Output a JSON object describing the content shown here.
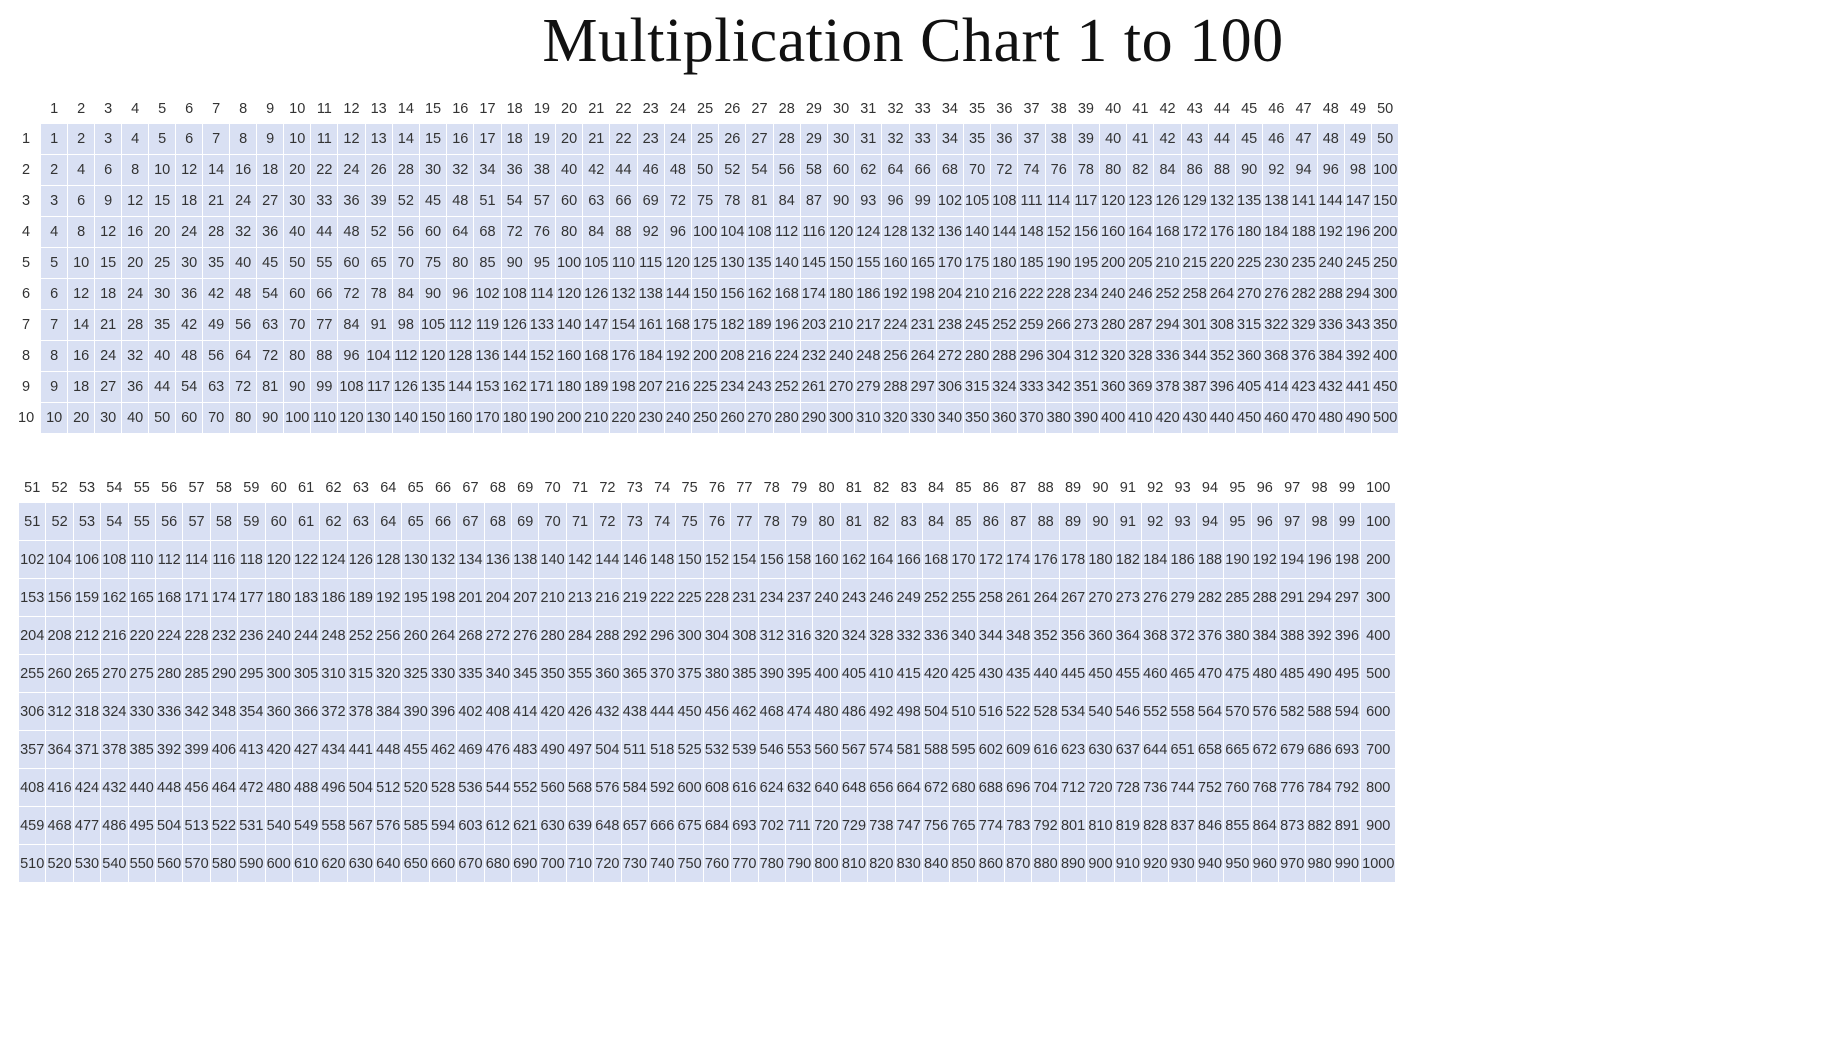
{
  "title": "Multiplication Chart 1 to 100",
  "chart_data": [
    {
      "type": "table",
      "title": "Rows 1–10 × Columns 1–50",
      "col_headers": [
        1,
        2,
        3,
        4,
        5,
        6,
        7,
        8,
        9,
        10,
        11,
        12,
        13,
        14,
        15,
        16,
        17,
        18,
        19,
        20,
        21,
        22,
        23,
        24,
        25,
        26,
        27,
        28,
        29,
        30,
        31,
        32,
        33,
        34,
        35,
        36,
        37,
        38,
        39,
        40,
        41,
        42,
        43,
        44,
        45,
        46,
        47,
        48,
        49,
        50
      ],
      "row_headers": [
        1,
        2,
        3,
        4,
        5,
        6,
        7,
        8,
        9,
        10
      ],
      "rows": [
        [
          1,
          2,
          3,
          4,
          5,
          6,
          7,
          8,
          9,
          10,
          11,
          12,
          13,
          14,
          15,
          16,
          17,
          18,
          19,
          20,
          21,
          22,
          23,
          24,
          25,
          26,
          27,
          28,
          29,
          30,
          31,
          32,
          33,
          34,
          35,
          36,
          37,
          38,
          39,
          40,
          41,
          42,
          43,
          44,
          45,
          46,
          47,
          48,
          49,
          50
        ],
        [
          2,
          4,
          6,
          8,
          10,
          12,
          14,
          16,
          18,
          20,
          22,
          24,
          26,
          28,
          30,
          32,
          34,
          36,
          38,
          40,
          42,
          44,
          46,
          48,
          50,
          52,
          54,
          56,
          58,
          60,
          62,
          64,
          66,
          68,
          70,
          72,
          74,
          76,
          78,
          80,
          82,
          84,
          86,
          88,
          90,
          92,
          94,
          96,
          98,
          100
        ],
        [
          3,
          6,
          9,
          12,
          15,
          18,
          21,
          24,
          27,
          30,
          33,
          36,
          39,
          52,
          45,
          48,
          51,
          54,
          57,
          60,
          63,
          66,
          69,
          72,
          75,
          78,
          81,
          84,
          87,
          90,
          93,
          96,
          99,
          102,
          105,
          108,
          111,
          114,
          117,
          120,
          123,
          126,
          129,
          132,
          135,
          138,
          141,
          144,
          147,
          150
        ],
        [
          4,
          8,
          12,
          16,
          20,
          24,
          28,
          32,
          36,
          40,
          44,
          48,
          52,
          56,
          60,
          64,
          68,
          72,
          76,
          80,
          84,
          88,
          92,
          96,
          100,
          104,
          108,
          112,
          116,
          120,
          124,
          128,
          132,
          136,
          140,
          144,
          148,
          152,
          156,
          160,
          164,
          168,
          172,
          176,
          180,
          184,
          188,
          192,
          196,
          200
        ],
        [
          5,
          10,
          15,
          20,
          25,
          30,
          35,
          40,
          45,
          50,
          55,
          60,
          65,
          70,
          75,
          80,
          85,
          90,
          95,
          100,
          105,
          110,
          115,
          120,
          125,
          130,
          135,
          140,
          145,
          150,
          155,
          160,
          165,
          170,
          175,
          180,
          185,
          190,
          195,
          200,
          205,
          210,
          215,
          220,
          225,
          230,
          235,
          240,
          245,
          250
        ],
        [
          6,
          12,
          18,
          24,
          30,
          36,
          42,
          48,
          54,
          60,
          66,
          72,
          78,
          84,
          90,
          96,
          102,
          108,
          114,
          120,
          126,
          132,
          138,
          144,
          150,
          156,
          162,
          168,
          174,
          180,
          186,
          192,
          198,
          204,
          210,
          216,
          222,
          228,
          234,
          240,
          246,
          252,
          258,
          264,
          270,
          276,
          282,
          288,
          294,
          300
        ],
        [
          7,
          14,
          21,
          28,
          35,
          42,
          49,
          56,
          63,
          70,
          77,
          84,
          91,
          98,
          105,
          112,
          119,
          126,
          133,
          140,
          147,
          154,
          161,
          168,
          175,
          182,
          189,
          196,
          203,
          210,
          217,
          224,
          231,
          238,
          245,
          252,
          259,
          266,
          273,
          280,
          287,
          294,
          301,
          308,
          315,
          322,
          329,
          336,
          343,
          350
        ],
        [
          8,
          16,
          24,
          32,
          40,
          48,
          56,
          64,
          72,
          80,
          88,
          96,
          104,
          112,
          120,
          128,
          136,
          144,
          152,
          160,
          168,
          176,
          184,
          192,
          200,
          208,
          216,
          224,
          232,
          240,
          248,
          256,
          264,
          272,
          280,
          288,
          296,
          304,
          312,
          320,
          328,
          336,
          344,
          352,
          360,
          368,
          376,
          384,
          392,
          400
        ],
        [
          9,
          18,
          27,
          36,
          44,
          54,
          63,
          72,
          81,
          90,
          99,
          108,
          117,
          126,
          135,
          144,
          153,
          162,
          171,
          180,
          189,
          198,
          207,
          216,
          225,
          234,
          243,
          252,
          261,
          270,
          279,
          288,
          297,
          306,
          315,
          324,
          333,
          342,
          351,
          360,
          369,
          378,
          387,
          396,
          405,
          414,
          423,
          432,
          441,
          450
        ],
        [
          10,
          20,
          30,
          40,
          50,
          60,
          70,
          80,
          90,
          100,
          110,
          120,
          130,
          140,
          150,
          160,
          170,
          180,
          190,
          200,
          210,
          220,
          230,
          240,
          250,
          260,
          270,
          280,
          290,
          300,
          310,
          320,
          330,
          340,
          350,
          360,
          370,
          380,
          390,
          400,
          410,
          420,
          430,
          440,
          450,
          460,
          470,
          480,
          490,
          500
        ]
      ]
    },
    {
      "type": "table",
      "title": "Rows 1–10 × Columns 51–100",
      "col_headers": [
        51,
        52,
        53,
        54,
        55,
        56,
        57,
        58,
        59,
        60,
        61,
        62,
        63,
        64,
        65,
        66,
        67,
        68,
        69,
        70,
        71,
        72,
        73,
        74,
        75,
        76,
        77,
        78,
        79,
        80,
        81,
        82,
        83,
        84,
        85,
        86,
        87,
        88,
        89,
        90,
        91,
        92,
        93,
        94,
        95,
        96,
        97,
        98,
        99,
        100
      ],
      "row_headers": [],
      "rows": [
        [
          51,
          52,
          53,
          54,
          55,
          56,
          57,
          58,
          59,
          60,
          61,
          62,
          63,
          64,
          65,
          66,
          67,
          68,
          69,
          70,
          71,
          72,
          73,
          74,
          75,
          76,
          77,
          78,
          79,
          80,
          81,
          82,
          83,
          84,
          85,
          86,
          87,
          88,
          89,
          90,
          91,
          92,
          93,
          94,
          95,
          96,
          97,
          98,
          99,
          100
        ],
        [
          102,
          104,
          106,
          108,
          110,
          112,
          114,
          116,
          118,
          120,
          122,
          124,
          126,
          128,
          130,
          132,
          134,
          136,
          138,
          140,
          142,
          144,
          146,
          148,
          150,
          152,
          154,
          156,
          158,
          160,
          162,
          164,
          166,
          168,
          170,
          172,
          174,
          176,
          178,
          180,
          182,
          184,
          186,
          188,
          190,
          192,
          194,
          196,
          198,
          200
        ],
        [
          153,
          156,
          159,
          162,
          165,
          168,
          171,
          174,
          177,
          180,
          183,
          186,
          189,
          192,
          195,
          198,
          201,
          204,
          207,
          210,
          213,
          216,
          219,
          222,
          225,
          228,
          231,
          234,
          237,
          240,
          243,
          246,
          249,
          252,
          255,
          258,
          261,
          264,
          267,
          270,
          273,
          276,
          279,
          282,
          285,
          288,
          291,
          294,
          297,
          300
        ],
        [
          204,
          208,
          212,
          216,
          220,
          224,
          228,
          232,
          236,
          240,
          244,
          248,
          252,
          256,
          260,
          264,
          268,
          272,
          276,
          280,
          284,
          288,
          292,
          296,
          300,
          304,
          308,
          312,
          316,
          320,
          324,
          328,
          332,
          336,
          340,
          344,
          348,
          352,
          356,
          360,
          364,
          368,
          372,
          376,
          380,
          384,
          388,
          392,
          396,
          400
        ],
        [
          255,
          260,
          265,
          270,
          275,
          280,
          285,
          290,
          295,
          300,
          305,
          310,
          315,
          320,
          325,
          330,
          335,
          340,
          345,
          350,
          355,
          360,
          365,
          370,
          375,
          380,
          385,
          390,
          395,
          400,
          405,
          410,
          415,
          420,
          425,
          430,
          435,
          440,
          445,
          450,
          455,
          460,
          465,
          470,
          475,
          480,
          485,
          490,
          495,
          500
        ],
        [
          306,
          312,
          318,
          324,
          330,
          336,
          342,
          348,
          354,
          360,
          366,
          372,
          378,
          384,
          390,
          396,
          402,
          408,
          414,
          420,
          426,
          432,
          438,
          444,
          450,
          456,
          462,
          468,
          474,
          480,
          486,
          492,
          498,
          504,
          510,
          516,
          522,
          528,
          534,
          540,
          546,
          552,
          558,
          564,
          570,
          576,
          582,
          588,
          594,
          600
        ],
        [
          357,
          364,
          371,
          378,
          385,
          392,
          399,
          406,
          413,
          420,
          427,
          434,
          441,
          448,
          455,
          462,
          469,
          476,
          483,
          490,
          497,
          504,
          511,
          518,
          525,
          532,
          539,
          546,
          553,
          560,
          567,
          574,
          581,
          588,
          595,
          602,
          609,
          616,
          623,
          630,
          637,
          644,
          651,
          658,
          665,
          672,
          679,
          686,
          693,
          700
        ],
        [
          408,
          416,
          424,
          432,
          440,
          448,
          456,
          464,
          472,
          480,
          488,
          496,
          504,
          512,
          520,
          528,
          536,
          544,
          552,
          560,
          568,
          576,
          584,
          592,
          600,
          608,
          616,
          624,
          632,
          640,
          648,
          656,
          664,
          672,
          680,
          688,
          696,
          704,
          712,
          720,
          728,
          736,
          744,
          752,
          760,
          768,
          776,
          784,
          792,
          800
        ],
        [
          459,
          468,
          477,
          486,
          495,
          504,
          513,
          522,
          531,
          540,
          549,
          558,
          567,
          576,
          585,
          594,
          603,
          612,
          621,
          630,
          639,
          648,
          657,
          666,
          675,
          684,
          693,
          702,
          711,
          720,
          729,
          738,
          747,
          756,
          765,
          774,
          783,
          792,
          801,
          810,
          819,
          828,
          837,
          846,
          855,
          864,
          873,
          882,
          891,
          900
        ],
        [
          510,
          520,
          530,
          540,
          550,
          560,
          570,
          580,
          590,
          600,
          610,
          620,
          630,
          640,
          650,
          660,
          670,
          680,
          690,
          700,
          710,
          720,
          730,
          740,
          750,
          760,
          770,
          780,
          790,
          800,
          810,
          820,
          830,
          840,
          850,
          860,
          870,
          880,
          890,
          900,
          910,
          920,
          930,
          940,
          950,
          960,
          970,
          980,
          990,
          1000
        ]
      ]
    }
  ]
}
